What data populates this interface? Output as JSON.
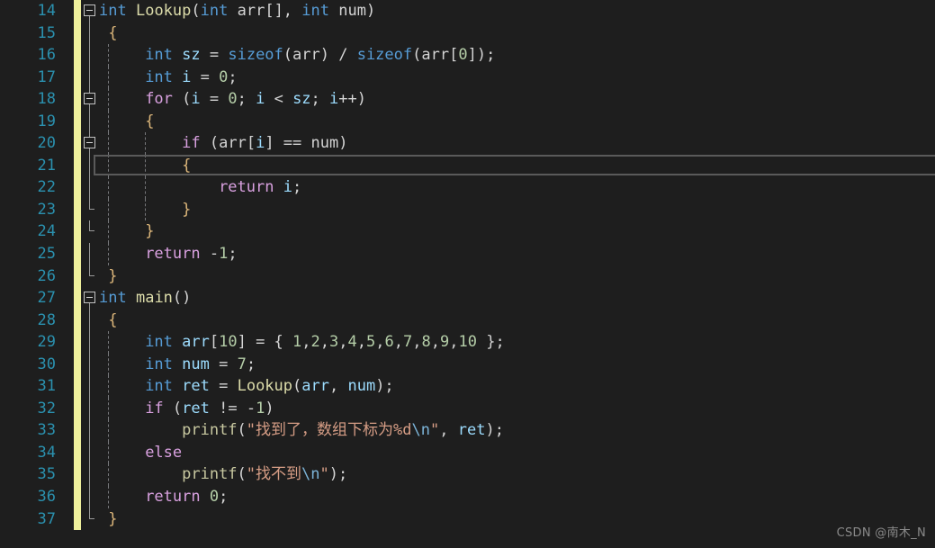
{
  "editor": {
    "theme": "visual-studio-dark",
    "language": "C",
    "background_color": "#1e1e1e",
    "line_number_color": "#2b91af",
    "change_bar_color": "#eff09c",
    "current_line": 21,
    "first_visible_line": 14,
    "last_visible_line": 37
  },
  "watermark": {
    "text": "CSDN @南木_N"
  },
  "lines": [
    {
      "n": "14",
      "changed": true,
      "text": "int Lookup(int arr[], int num)"
    },
    {
      "n": "15",
      "changed": true,
      "text": " {"
    },
    {
      "n": "16",
      "changed": true,
      "text": "     int sz = sizeof(arr) / sizeof(arr[0]);"
    },
    {
      "n": "17",
      "changed": true,
      "text": "     int i = 0;"
    },
    {
      "n": "18",
      "changed": true,
      "text": "     for (i = 0; i < sz; i++)"
    },
    {
      "n": "19",
      "changed": true,
      "text": "     {"
    },
    {
      "n": "20",
      "changed": true,
      "text": "         if (arr[i] == num)"
    },
    {
      "n": "21",
      "changed": true,
      "text": "         {"
    },
    {
      "n": "22",
      "changed": true,
      "text": "             return i;"
    },
    {
      "n": "23",
      "changed": true,
      "text": "         }"
    },
    {
      "n": "24",
      "changed": true,
      "text": "     }"
    },
    {
      "n": "25",
      "changed": true,
      "text": "     return -1;"
    },
    {
      "n": "26",
      "changed": true,
      "text": " }"
    },
    {
      "n": "27",
      "changed": true,
      "text": "int main()"
    },
    {
      "n": "28",
      "changed": true,
      "text": " {"
    },
    {
      "n": "29",
      "changed": true,
      "text": "     int arr[10] = { 1,2,3,4,5,6,7,8,9,10 };"
    },
    {
      "n": "30",
      "changed": true,
      "text": "     int num = 7;"
    },
    {
      "n": "31",
      "changed": true,
      "text": "     int ret = Lookup(arr, num);"
    },
    {
      "n": "32",
      "changed": true,
      "text": "     if (ret != -1)"
    },
    {
      "n": "33",
      "changed": true,
      "text": "         printf(\"找到了，数组下标为%d\\n\", ret);"
    },
    {
      "n": "34",
      "changed": true,
      "text": "     else"
    },
    {
      "n": "35",
      "changed": true,
      "text": "         printf(\"找不到\\n\");"
    },
    {
      "n": "36",
      "changed": true,
      "text": "     return 0;"
    },
    {
      "n": "37",
      "changed": true,
      "text": " }"
    }
  ],
  "code_tokens": [
    [
      {
        "t": "int",
        "c": "kw"
      },
      {
        "t": " ",
        "c": "br"
      },
      {
        "t": "Lookup",
        "c": "fn"
      },
      {
        "t": "(",
        "c": "br"
      },
      {
        "t": "int",
        "c": "kw"
      },
      {
        "t": " ",
        "c": "br"
      },
      {
        "t": "arr",
        "c": "id"
      },
      {
        "t": "[], ",
        "c": "br"
      },
      {
        "t": "int",
        "c": "kw"
      },
      {
        "t": " ",
        "c": "br"
      },
      {
        "t": "num",
        "c": "id"
      },
      {
        "t": ")",
        "c": "br"
      }
    ],
    [
      {
        "t": " ",
        "c": "br"
      },
      {
        "t": "{",
        "c": "cbr"
      }
    ],
    [
      {
        "t": "     ",
        "c": "br"
      },
      {
        "t": "int",
        "c": "kw"
      },
      {
        "t": " ",
        "c": "br"
      },
      {
        "t": "sz",
        "c": "var"
      },
      {
        "t": " = ",
        "c": "br"
      },
      {
        "t": "sizeof",
        "c": "kw"
      },
      {
        "t": "(",
        "c": "br"
      },
      {
        "t": "arr",
        "c": "id"
      },
      {
        "t": ") / ",
        "c": "br"
      },
      {
        "t": "sizeof",
        "c": "kw"
      },
      {
        "t": "(",
        "c": "br"
      },
      {
        "t": "arr",
        "c": "id"
      },
      {
        "t": "[",
        "c": "br"
      },
      {
        "t": "0",
        "c": "num"
      },
      {
        "t": "]);",
        "c": "br"
      }
    ],
    [
      {
        "t": "     ",
        "c": "br"
      },
      {
        "t": "int",
        "c": "kw"
      },
      {
        "t": " ",
        "c": "br"
      },
      {
        "t": "i",
        "c": "var"
      },
      {
        "t": " = ",
        "c": "br"
      },
      {
        "t": "0",
        "c": "num"
      },
      {
        "t": ";",
        "c": "br"
      }
    ],
    [
      {
        "t": "     ",
        "c": "br"
      },
      {
        "t": "for",
        "c": "ctl"
      },
      {
        "t": " (",
        "c": "br"
      },
      {
        "t": "i",
        "c": "var"
      },
      {
        "t": " = ",
        "c": "br"
      },
      {
        "t": "0",
        "c": "num"
      },
      {
        "t": "; ",
        "c": "br"
      },
      {
        "t": "i",
        "c": "var"
      },
      {
        "t": " < ",
        "c": "br"
      },
      {
        "t": "sz",
        "c": "var"
      },
      {
        "t": "; ",
        "c": "br"
      },
      {
        "t": "i",
        "c": "var"
      },
      {
        "t": "++)",
        "c": "br"
      }
    ],
    [
      {
        "t": "     ",
        "c": "br"
      },
      {
        "t": "{",
        "c": "cbr"
      }
    ],
    [
      {
        "t": "         ",
        "c": "br"
      },
      {
        "t": "if",
        "c": "ctl"
      },
      {
        "t": " (",
        "c": "br"
      },
      {
        "t": "arr",
        "c": "id"
      },
      {
        "t": "[",
        "c": "br"
      },
      {
        "t": "i",
        "c": "var"
      },
      {
        "t": "] == ",
        "c": "br"
      },
      {
        "t": "num",
        "c": "id"
      },
      {
        "t": ")",
        "c": "br"
      }
    ],
    [
      {
        "t": "         ",
        "c": "br"
      },
      {
        "t": "{",
        "c": "cbr"
      }
    ],
    [
      {
        "t": "             ",
        "c": "br"
      },
      {
        "t": "return",
        "c": "ctl"
      },
      {
        "t": " ",
        "c": "br"
      },
      {
        "t": "i",
        "c": "var"
      },
      {
        "t": ";",
        "c": "br"
      }
    ],
    [
      {
        "t": "         ",
        "c": "br"
      },
      {
        "t": "}",
        "c": "cbr"
      }
    ],
    [
      {
        "t": "     ",
        "c": "br"
      },
      {
        "t": "}",
        "c": "cbr"
      }
    ],
    [
      {
        "t": "     ",
        "c": "br"
      },
      {
        "t": "return",
        "c": "ctl"
      },
      {
        "t": " -",
        "c": "br"
      },
      {
        "t": "1",
        "c": "num"
      },
      {
        "t": ";",
        "c": "br"
      }
    ],
    [
      {
        "t": " ",
        "c": "br"
      },
      {
        "t": "}",
        "c": "cbr"
      }
    ],
    [
      {
        "t": "int",
        "c": "kw"
      },
      {
        "t": " ",
        "c": "br"
      },
      {
        "t": "main",
        "c": "fn"
      },
      {
        "t": "()",
        "c": "br"
      }
    ],
    [
      {
        "t": " ",
        "c": "br"
      },
      {
        "t": "{",
        "c": "cbr"
      }
    ],
    [
      {
        "t": "     ",
        "c": "br"
      },
      {
        "t": "int",
        "c": "kw"
      },
      {
        "t": " ",
        "c": "br"
      },
      {
        "t": "arr",
        "c": "var"
      },
      {
        "t": "[",
        "c": "br"
      },
      {
        "t": "10",
        "c": "num"
      },
      {
        "t": "] = { ",
        "c": "br"
      },
      {
        "t": "1",
        "c": "num"
      },
      {
        "t": ",",
        "c": "br"
      },
      {
        "t": "2",
        "c": "num"
      },
      {
        "t": ",",
        "c": "br"
      },
      {
        "t": "3",
        "c": "num"
      },
      {
        "t": ",",
        "c": "br"
      },
      {
        "t": "4",
        "c": "num"
      },
      {
        "t": ",",
        "c": "br"
      },
      {
        "t": "5",
        "c": "num"
      },
      {
        "t": ",",
        "c": "br"
      },
      {
        "t": "6",
        "c": "num"
      },
      {
        "t": ",",
        "c": "br"
      },
      {
        "t": "7",
        "c": "num"
      },
      {
        "t": ",",
        "c": "br"
      },
      {
        "t": "8",
        "c": "num"
      },
      {
        "t": ",",
        "c": "br"
      },
      {
        "t": "9",
        "c": "num"
      },
      {
        "t": ",",
        "c": "br"
      },
      {
        "t": "10",
        "c": "num"
      },
      {
        "t": " };",
        "c": "br"
      }
    ],
    [
      {
        "t": "     ",
        "c": "br"
      },
      {
        "t": "int",
        "c": "kw"
      },
      {
        "t": " ",
        "c": "br"
      },
      {
        "t": "num",
        "c": "var"
      },
      {
        "t": " = ",
        "c": "br"
      },
      {
        "t": "7",
        "c": "num"
      },
      {
        "t": ";",
        "c": "br"
      }
    ],
    [
      {
        "t": "     ",
        "c": "br"
      },
      {
        "t": "int",
        "c": "kw"
      },
      {
        "t": " ",
        "c": "br"
      },
      {
        "t": "ret",
        "c": "var"
      },
      {
        "t": " = ",
        "c": "br"
      },
      {
        "t": "Lookup",
        "c": "fn"
      },
      {
        "t": "(",
        "c": "br"
      },
      {
        "t": "arr",
        "c": "var"
      },
      {
        "t": ", ",
        "c": "br"
      },
      {
        "t": "num",
        "c": "var"
      },
      {
        "t": ");",
        "c": "br"
      }
    ],
    [
      {
        "t": "     ",
        "c": "br"
      },
      {
        "t": "if",
        "c": "ctl"
      },
      {
        "t": " (",
        "c": "br"
      },
      {
        "t": "ret",
        "c": "var"
      },
      {
        "t": " != -",
        "c": "br"
      },
      {
        "t": "1",
        "c": "num"
      },
      {
        "t": ")",
        "c": "br"
      }
    ],
    [
      {
        "t": "         ",
        "c": "br"
      },
      {
        "t": "printf",
        "c": "fnc"
      },
      {
        "t": "(",
        "c": "br"
      },
      {
        "t": "\"找到了，数组下标为%d",
        "c": "str"
      },
      {
        "t": "\\n",
        "c": "esc"
      },
      {
        "t": "\"",
        "c": "str"
      },
      {
        "t": ", ",
        "c": "br"
      },
      {
        "t": "ret",
        "c": "var"
      },
      {
        "t": ");",
        "c": "br"
      }
    ],
    [
      {
        "t": "     ",
        "c": "br"
      },
      {
        "t": "else",
        "c": "ctl"
      }
    ],
    [
      {
        "t": "         ",
        "c": "br"
      },
      {
        "t": "printf",
        "c": "fnc"
      },
      {
        "t": "(",
        "c": "br"
      },
      {
        "t": "\"找不到",
        "c": "str"
      },
      {
        "t": "\\n",
        "c": "esc"
      },
      {
        "t": "\"",
        "c": "str"
      },
      {
        "t": ");",
        "c": "br"
      }
    ],
    [
      {
        "t": "     ",
        "c": "br"
      },
      {
        "t": "return",
        "c": "ctl"
      },
      {
        "t": " ",
        "c": "br"
      },
      {
        "t": "0",
        "c": "num"
      },
      {
        "t": ";",
        "c": "br"
      }
    ],
    [
      {
        "t": " ",
        "c": "br"
      },
      {
        "t": "}",
        "c": "cbr"
      }
    ]
  ],
  "outlining": [
    {
      "line": "14",
      "glyph": "collapse-box",
      "vline": "bottom"
    },
    {
      "line": "15",
      "glyph": "none",
      "vline": "full"
    },
    {
      "line": "16",
      "glyph": "none",
      "vline": "full"
    },
    {
      "line": "17",
      "glyph": "none",
      "vline": "full"
    },
    {
      "line": "18",
      "glyph": "collapse-box",
      "vline": "full"
    },
    {
      "line": "19",
      "glyph": "none",
      "vline": "full"
    },
    {
      "line": "20",
      "glyph": "collapse-box",
      "vline": "full"
    },
    {
      "line": "21",
      "glyph": "none",
      "vline": "full"
    },
    {
      "line": "22",
      "glyph": "none",
      "vline": "full"
    },
    {
      "line": "23",
      "glyph": "none",
      "vline": "top-elbow"
    },
    {
      "line": "24",
      "glyph": "none",
      "vline": "top-elbow"
    },
    {
      "line": "25",
      "glyph": "none",
      "vline": "full"
    },
    {
      "line": "26",
      "glyph": "none",
      "vline": "top-elbow"
    },
    {
      "line": "27",
      "glyph": "collapse-box",
      "vline": "bottom"
    },
    {
      "line": "28",
      "glyph": "none",
      "vline": "full"
    },
    {
      "line": "29",
      "glyph": "none",
      "vline": "full"
    },
    {
      "line": "30",
      "glyph": "none",
      "vline": "full"
    },
    {
      "line": "31",
      "glyph": "none",
      "vline": "full"
    },
    {
      "line": "32",
      "glyph": "none",
      "vline": "full"
    },
    {
      "line": "33",
      "glyph": "none",
      "vline": "full"
    },
    {
      "line": "34",
      "glyph": "none",
      "vline": "full"
    },
    {
      "line": "35",
      "glyph": "none",
      "vline": "full"
    },
    {
      "line": "36",
      "glyph": "none",
      "vline": "full"
    },
    {
      "line": "37",
      "glyph": "none",
      "vline": "top-elbow"
    }
  ],
  "indent_guides": [
    {
      "line": "14",
      "x": []
    },
    {
      "line": "15",
      "x": []
    },
    {
      "line": "16",
      "x": [
        120
      ]
    },
    {
      "line": "17",
      "x": [
        120
      ]
    },
    {
      "line": "18",
      "x": [
        120
      ]
    },
    {
      "line": "19",
      "x": [
        120
      ]
    },
    {
      "line": "20",
      "x": [
        120,
        161
      ]
    },
    {
      "line": "21",
      "x": [
        120,
        161
      ]
    },
    {
      "line": "22",
      "x": [
        120,
        161
      ]
    },
    {
      "line": "23",
      "x": [
        120,
        161
      ]
    },
    {
      "line": "24",
      "x": [
        120
      ]
    },
    {
      "line": "25",
      "x": [
        120
      ]
    },
    {
      "line": "26",
      "x": []
    },
    {
      "line": "27",
      "x": []
    },
    {
      "line": "28",
      "x": []
    },
    {
      "line": "29",
      "x": [
        120
      ]
    },
    {
      "line": "30",
      "x": [
        120
      ]
    },
    {
      "line": "31",
      "x": [
        120
      ]
    },
    {
      "line": "32",
      "x": [
        120
      ]
    },
    {
      "line": "33",
      "x": [
        120
      ]
    },
    {
      "line": "34",
      "x": [
        120
      ]
    },
    {
      "line": "35",
      "x": [
        120
      ]
    },
    {
      "line": "36",
      "x": [
        120
      ]
    },
    {
      "line": "37",
      "x": []
    }
  ]
}
